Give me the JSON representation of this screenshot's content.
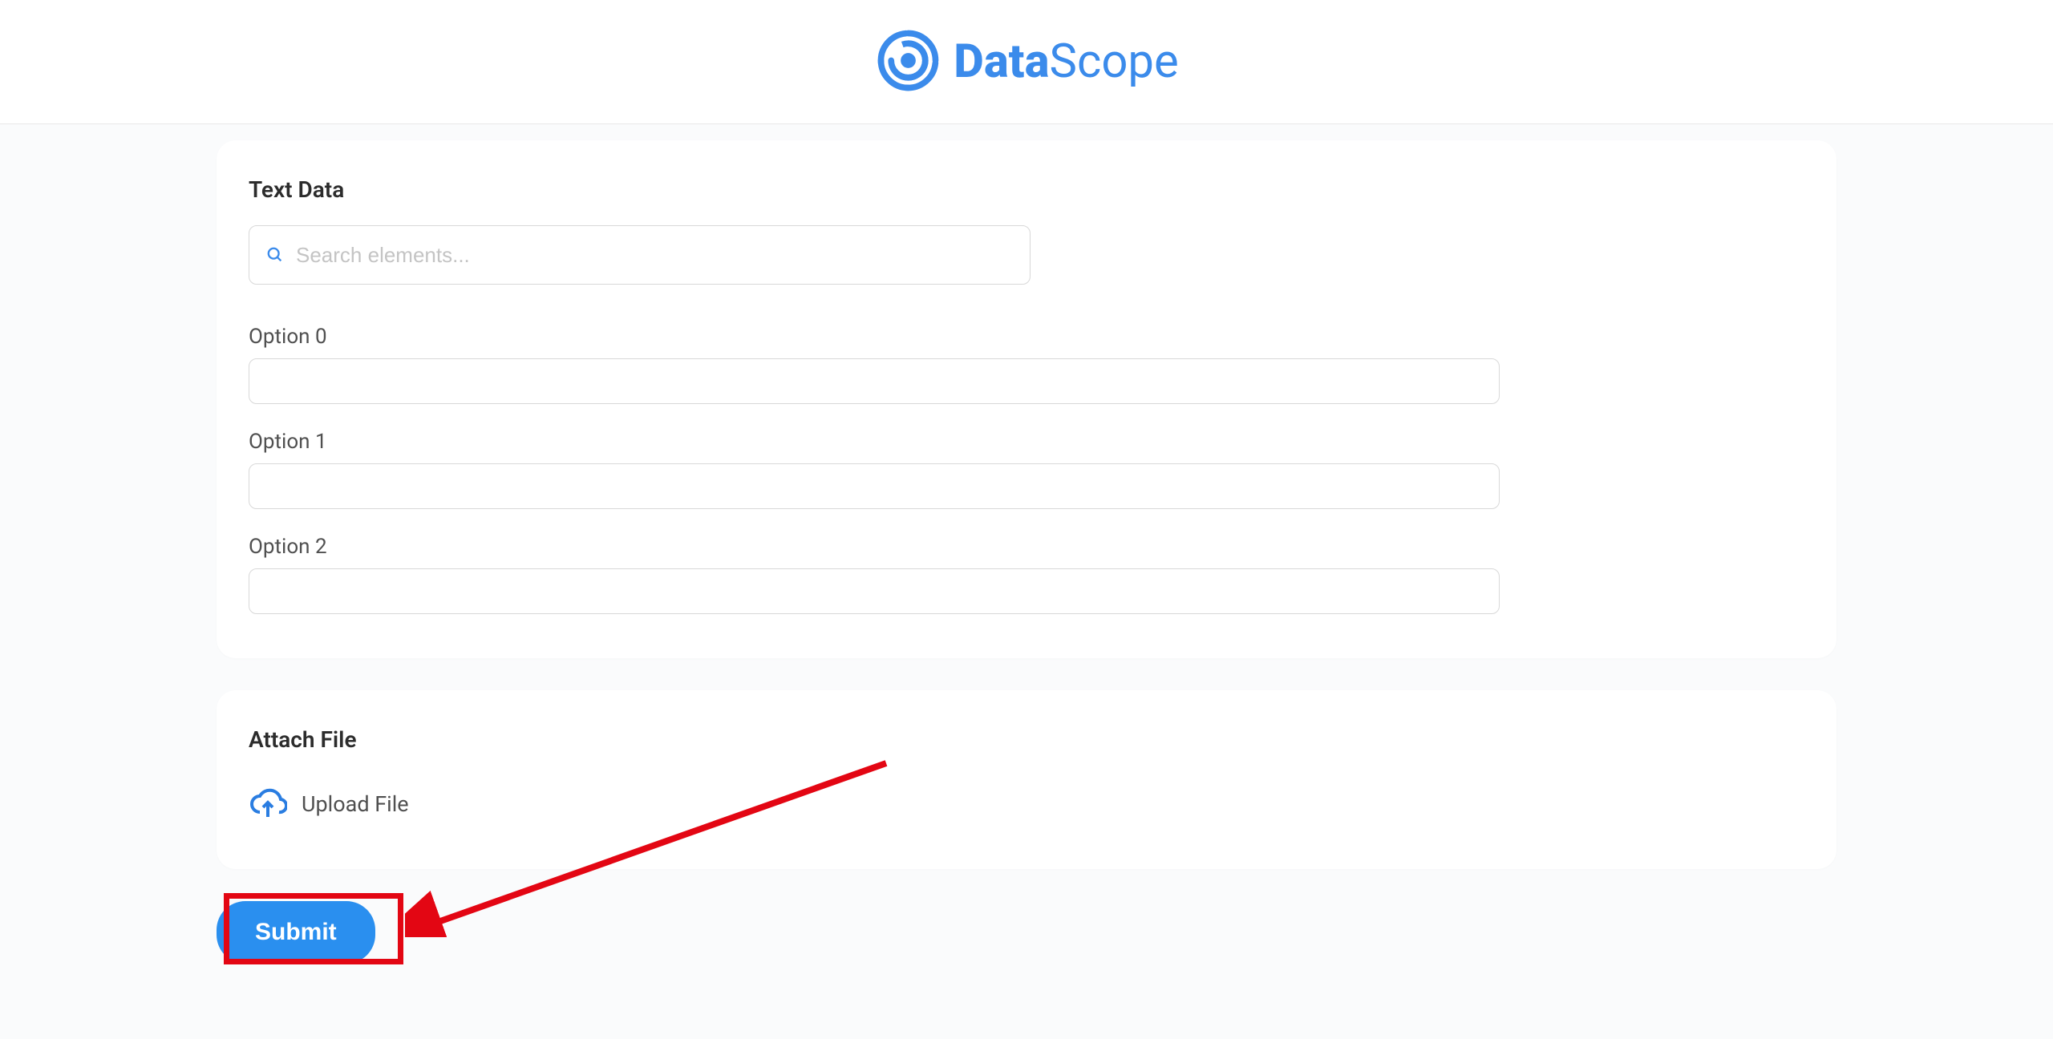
{
  "logo": {
    "text_bold": "Data",
    "text_light": "Scope"
  },
  "form": {
    "section1_title": "Text Data",
    "search_placeholder": "Search elements...",
    "options": [
      {
        "label": "Option 0",
        "value": ""
      },
      {
        "label": "Option 1",
        "value": ""
      },
      {
        "label": "Option 2",
        "value": ""
      }
    ],
    "section2_title": "Attach File",
    "upload_label": "Upload File",
    "submit_label": "Submit"
  }
}
